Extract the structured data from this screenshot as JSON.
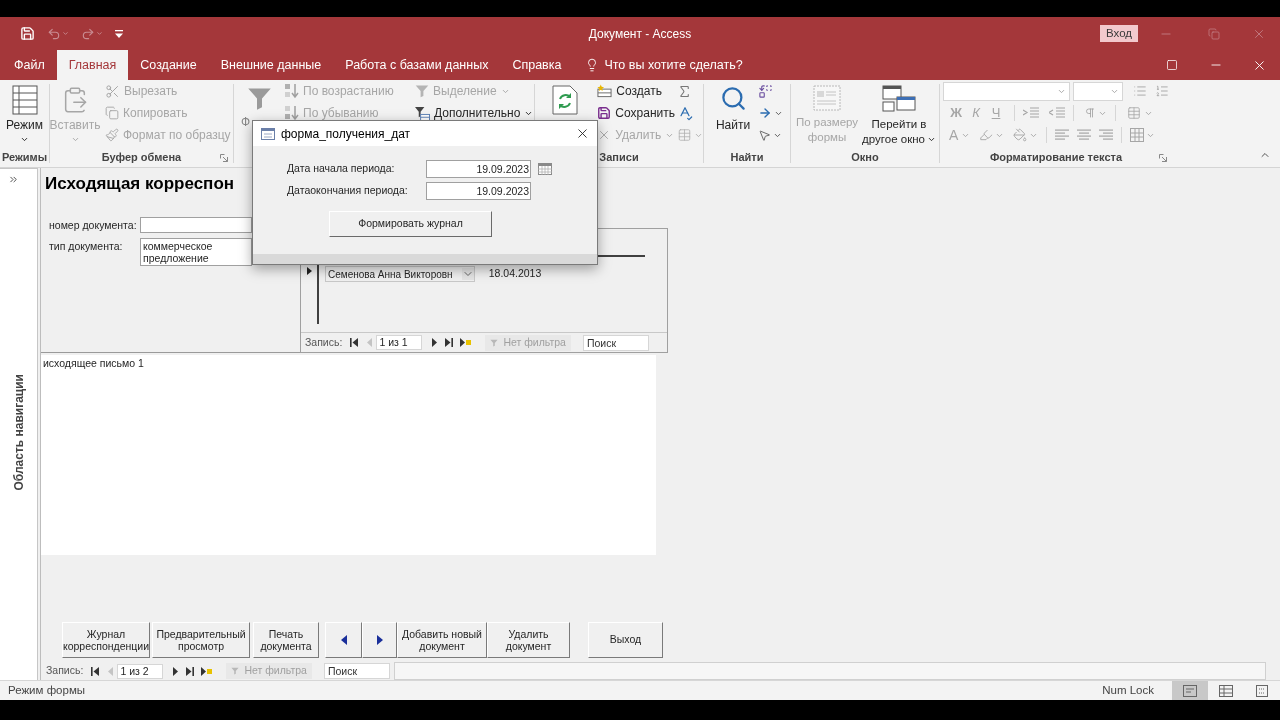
{
  "title_bar": {
    "title": "Документ  -  Access",
    "sign_in": "Вход"
  },
  "tabs": [
    {
      "label": "Файл",
      "selected": false
    },
    {
      "label": "Главная",
      "selected": true
    },
    {
      "label": "Создание",
      "selected": false
    },
    {
      "label": "Внешние данные",
      "selected": false
    },
    {
      "label": "Работа с базами данных",
      "selected": false
    },
    {
      "label": "Справка",
      "selected": false
    }
  ],
  "tell_me": "Что вы хотите сделать?",
  "ribbon": {
    "views": {
      "label": "Режимы",
      "button": "Режим"
    },
    "clipboard": {
      "label": "Буфер обмена",
      "paste": {
        "label": "Вставить",
        "disabled": true
      },
      "items": [
        {
          "kind": "cut",
          "label": "Вырезать",
          "disabled": true
        },
        {
          "kind": "copy",
          "label": "Копировать",
          "disabled": true
        },
        {
          "kind": "painter",
          "label": "Формат по образцу",
          "disabled": true
        }
      ]
    },
    "sort_filter": {
      "filter": "Ф",
      "sort": [
        {
          "kind": "ascending",
          "label": "По возрастанию",
          "disabled": true
        },
        {
          "kind": "descending",
          "label": "По убыванию",
          "disabled": true
        }
      ],
      "filters": [
        {
          "kind": "selection",
          "label": "Выделение",
          "disabled": true
        },
        {
          "kind": "advanced",
          "label": "Дополнительно",
          "disabled": false
        }
      ]
    },
    "records": {
      "label": "Записи",
      "items": [
        {
          "kind": "new",
          "label": "Создать",
          "disabled": false
        },
        {
          "kind": "save",
          "label": "Сохранить",
          "disabled": false
        },
        {
          "kind": "delete",
          "label": "Удалить",
          "disabled": true
        }
      ]
    },
    "find": {
      "label": "Найти",
      "button": "Найти"
    },
    "window": {
      "label": "Окно",
      "buttons": [
        {
          "kind": "fit",
          "label": "По размеру формы",
          "disabled": true
        },
        {
          "kind": "switch",
          "label": "Перейти в другое окно",
          "disabled": false
        }
      ]
    },
    "text_formatting": {
      "label": "Форматирование текста",
      "styles": [
        "Ж",
        "К",
        "Ч"
      ],
      "font_color": "A"
    }
  },
  "nav_pane": {
    "title": "Область навигации"
  },
  "form": {
    "title": "Исходящая корреспон",
    "fields": [
      {
        "label": "номер документа:"
      },
      {
        "label": "тип документа:",
        "value": "коммерческое предложение"
      }
    ],
    "subform": {
      "rows": [
        {
          "current": true,
          "name": "Семенова Анна Викторовн",
          "date": "18.04.2013"
        }
      ],
      "nav": {
        "label": "Запись:",
        "position": "1 из 1",
        "filter": "Нет фильтра",
        "search": {
          "placeholder": "Поиск"
        }
      }
    },
    "memo": "исходящее письмо 1",
    "buttons": [
      {
        "kind": "text",
        "label": "Журнал корреспонденции"
      },
      {
        "kind": "text",
        "label": "Предварительный просмотр"
      },
      {
        "kind": "text",
        "label": "Печать документа"
      },
      {
        "kind": "prev"
      },
      {
        "kind": "next"
      },
      {
        "kind": "text",
        "label": "Добавить новый документ"
      },
      {
        "kind": "text",
        "label": "Удалить документ"
      }
    ],
    "exit_button": "Выход",
    "nav": {
      "label": "Запись:",
      "position": "1 из 2",
      "filter": "Нет фильтра",
      "search": {
        "placeholder": "Поиск"
      }
    }
  },
  "dialog": {
    "title": "форма_получения_дат",
    "fields": [
      {
        "label": "Дата начала периода:",
        "value": "19.09.2023",
        "calendar": true
      },
      {
        "label": "Датаокончания периода:",
        "value": "19.09.2023",
        "calendar": false
      }
    ],
    "button": "Формировать журнал"
  },
  "status_bar": {
    "mode": "Режим формы",
    "num_lock": "Num Lock",
    "views": [
      {
        "kind": "form",
        "selected": true
      },
      {
        "kind": "datasheet",
        "selected": false
      },
      {
        "kind": "layout",
        "selected": false
      }
    ]
  }
}
